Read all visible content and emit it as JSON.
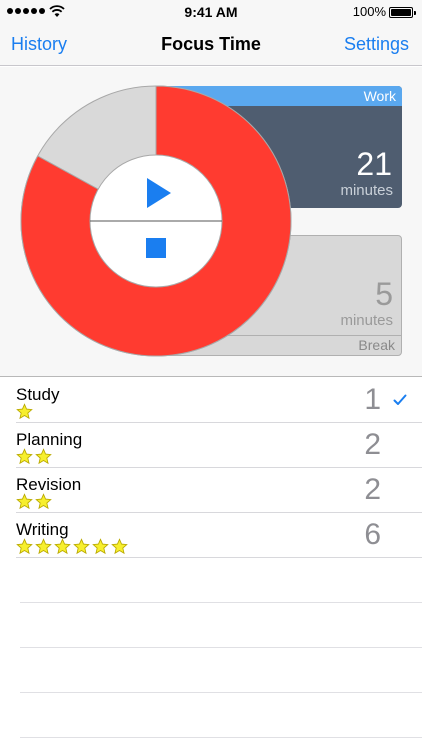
{
  "status_bar": {
    "time": "9:41 AM",
    "battery_percent": "100%",
    "signal_bars": 5,
    "icons": [
      "signal-dots-icon",
      "wifi-icon",
      "battery-icon"
    ]
  },
  "nav": {
    "left_label": "History",
    "title": "Focus Time",
    "right_label": "Settings"
  },
  "timer": {
    "work": {
      "label": "Work",
      "value": "21",
      "unit": "minutes"
    },
    "break": {
      "label": "Break",
      "value": "5",
      "unit": "minutes"
    },
    "progress_fraction": 0.83,
    "colors": {
      "ring_progress": "#ff3b30",
      "ring_remaining": "#d9d9d9",
      "control": "#1a7ef0",
      "work_panel": "#4f5d70",
      "work_header": "#5aa8ef"
    },
    "play_icon": "play-icon",
    "stop_icon": "stop-icon"
  },
  "sessions": [
    {
      "name": "Study",
      "stars": 1,
      "count": "1",
      "selected": true
    },
    {
      "name": "Planning",
      "stars": 2,
      "count": "2",
      "selected": false
    },
    {
      "name": "Revision",
      "stars": 2,
      "count": "2",
      "selected": false
    },
    {
      "name": "Writing",
      "stars": 6,
      "count": "6",
      "selected": false
    }
  ],
  "accent_color": "#1a7ef0"
}
